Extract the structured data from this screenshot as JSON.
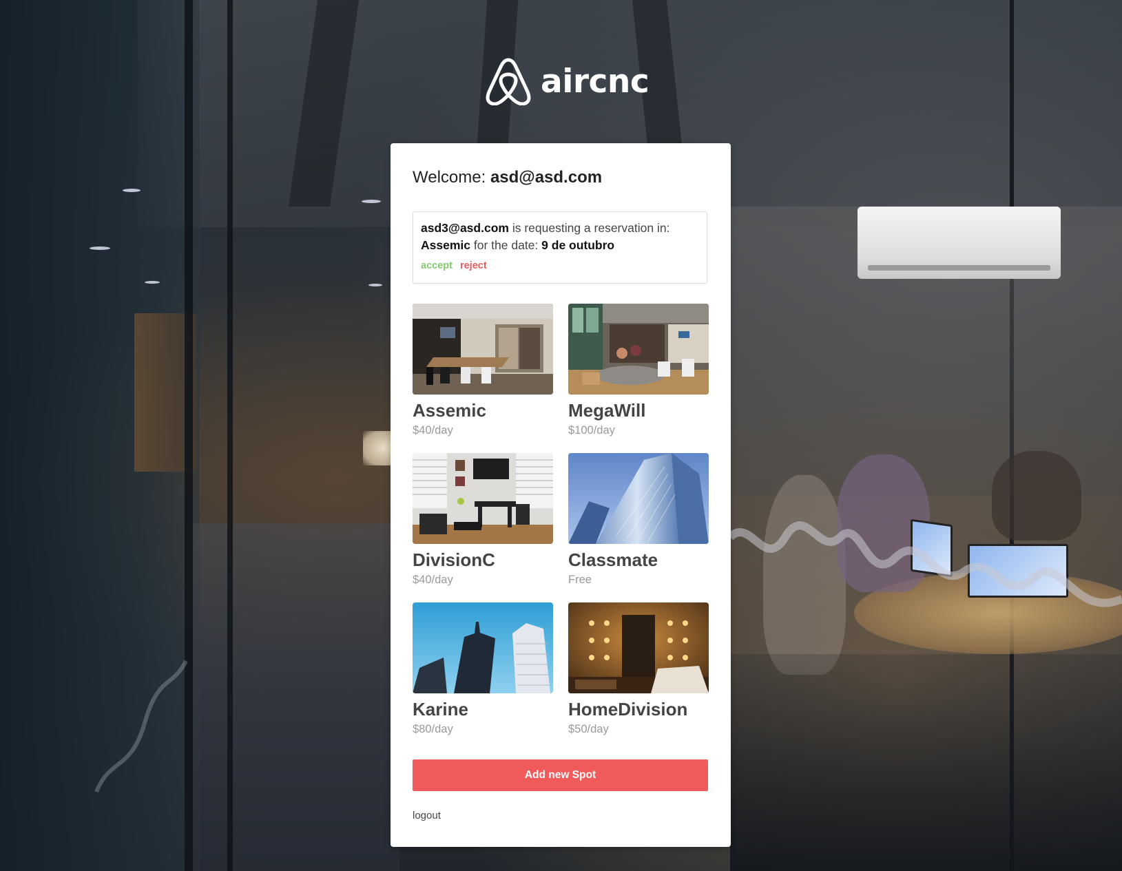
{
  "app": {
    "logo_text": "aircnc",
    "logo_icon": "airbnb-belo-icon"
  },
  "welcome": {
    "prefix": "Welcome:",
    "email": "asd@asd.com"
  },
  "request": {
    "requester": "asd3@asd.com",
    "text_requesting": "is requesting a reservation in:",
    "spot": "Assemic",
    "text_date": "for the date:",
    "date": "9 de outubro",
    "accept_label": "accept",
    "reject_label": "reject"
  },
  "spots": [
    {
      "name": "Assemic",
      "price": "$40/day"
    },
    {
      "name": "MegaWill",
      "price": "$100/day"
    },
    {
      "name": "DivisionC",
      "price": "$40/day"
    },
    {
      "name": "Classmate",
      "price": "Free"
    },
    {
      "name": "Karine",
      "price": "$80/day"
    },
    {
      "name": "HomeDivision",
      "price": "$50/day"
    }
  ],
  "actions": {
    "add_spot_label": "Add new Spot",
    "logout_label": "logout"
  },
  "colors": {
    "accent": "#f05a5b",
    "accept": "#84c870",
    "reject": "#e55e5e"
  }
}
